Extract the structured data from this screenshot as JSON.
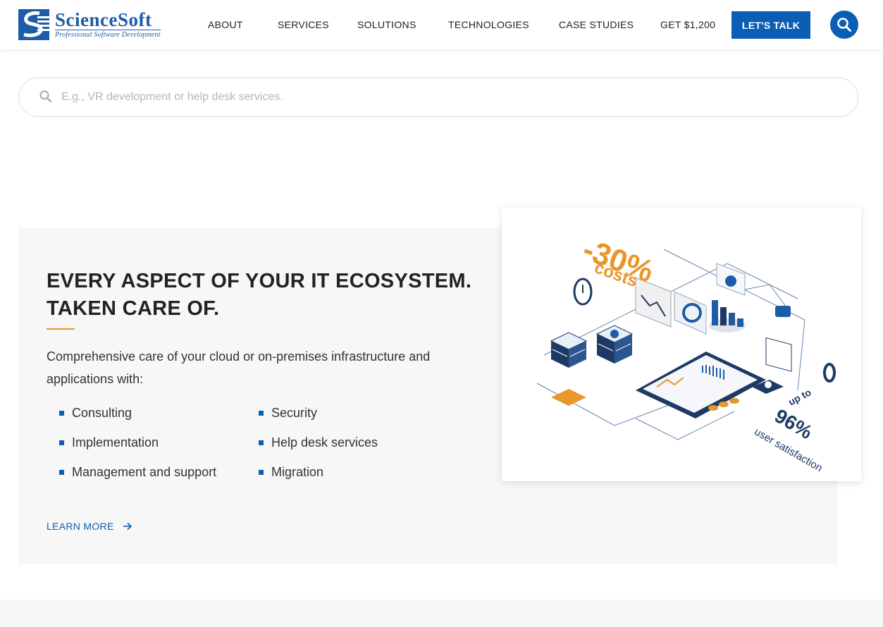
{
  "header": {
    "logo": {
      "name": "ScienceSoft",
      "tagline": "Professional Software Development"
    },
    "nav": [
      "ABOUT",
      "SERVICES",
      "SOLUTIONS",
      "TECHNOLOGIES",
      "CASE STUDIES",
      "GET $1,200"
    ],
    "cta_label": "LET'S TALK",
    "search_icon": "search-icon"
  },
  "search": {
    "placeholder": "E.g., VR development or help desk services.",
    "value": ""
  },
  "section": {
    "heading_line1": "EVERY ASPECT OF YOUR IT ECOSYSTEM.",
    "heading_line2": "TAKEN CARE OF.",
    "intro": "Comprehensive care of your cloud or on-premises infrastructure and applications with:",
    "items": [
      "Consulting",
      "Implementation",
      "Management and support",
      "Security",
      "Help desk services",
      "Migration"
    ],
    "learn_more": "LEARN MORE"
  },
  "illustration": {
    "costs_value": "-30%",
    "costs_label": "costs",
    "satisfaction_prefix": "up to",
    "satisfaction_value": "96%",
    "satisfaction_label": "user satisfaction"
  },
  "colors": {
    "brand_blue": "#0a5eb4",
    "accent_orange": "#e8972a",
    "panel_gray": "#f7f7f7"
  }
}
